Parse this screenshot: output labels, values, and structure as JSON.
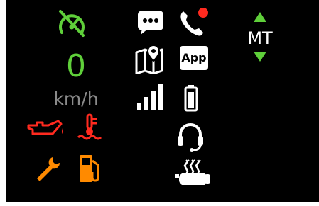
{
  "speedometer": {
    "value": "0",
    "unit": "km/h"
  },
  "gear": {
    "mode": "MT"
  },
  "app_button": {
    "label": "App"
  },
  "colors": {
    "background": "#000000",
    "active_green": "#5fcf3a",
    "warning_red": "#ff2a1f",
    "warning_orange": "#ff8a00",
    "unit_gray": "#8a8a8a",
    "icon_white": "#ffffff"
  },
  "icons": [
    "cruise-control-icon",
    "message-icon",
    "phone-call-icon",
    "gear-up-arrow-icon",
    "gear-down-arrow-icon",
    "map-navigation-icon",
    "app-icon",
    "signal-strength-icon",
    "battery-icon",
    "oil-pressure-warning-icon",
    "coolant-temperature-warning-icon",
    "headset-icon",
    "service-wrench-icon",
    "fuel-warning-icon",
    "heated-grip-icon"
  ]
}
